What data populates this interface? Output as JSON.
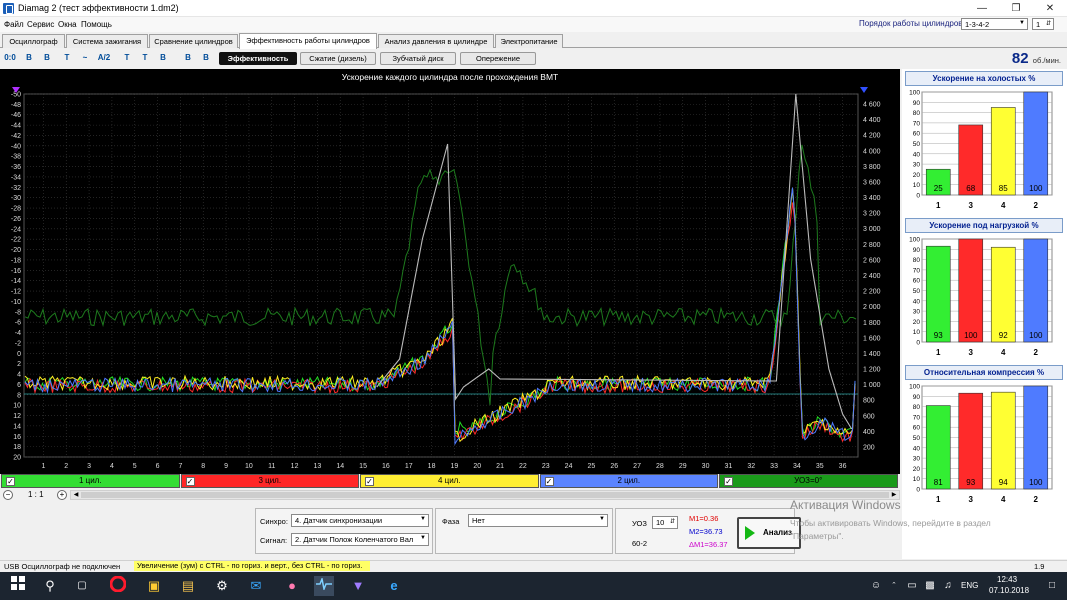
{
  "window": {
    "title": "Diamag 2 (тест эффективности 1.dm2)"
  },
  "menu": [
    "Файл",
    "Сервис",
    "Окна",
    "Помощь"
  ],
  "firing_order": {
    "label": "Порядок работы цилиндров",
    "value": "1-3-4-2",
    "index": "1"
  },
  "tabs": [
    "Осциллограф",
    "Система зажигания",
    "Сравнение цилиндров",
    "Эффективность работы цилиндров",
    "Анализ давления в цилиндре",
    "Электропитание"
  ],
  "toolbar": {
    "icons": [
      "0:0",
      "B",
      "B",
      "T",
      "~",
      "A/2",
      "T",
      "T",
      "B",
      "B",
      "B"
    ],
    "subtabs": [
      "Эффективность",
      "Сжатие (дизель)",
      "Зубчатый диск",
      "Опережение"
    ],
    "rpm_value": "82",
    "rpm_unit": "об./мин."
  },
  "chart": {
    "title": "Ускорение каждого цилиндра после прохождения ВМТ",
    "left_ticks": [
      "-50",
      "-48",
      "-46",
      "-44",
      "-42",
      "-40",
      "-38",
      "-36",
      "-34",
      "-32",
      "-30",
      "-28",
      "-26",
      "-24",
      "-22",
      "-20",
      "-18",
      "-16",
      "-14",
      "-12",
      "-10",
      "-8",
      "-6",
      "-4",
      "-2",
      "0",
      "2",
      "4",
      "6",
      "8",
      "10",
      "12",
      "14",
      "16",
      "18",
      "20"
    ],
    "right_ticks": [
      "4 600",
      "4 400",
      "4 200",
      "4 000",
      "3 800",
      "3 600",
      "3 400",
      "3 200",
      "3 000",
      "2 800",
      "2 600",
      "2 400",
      "2 200",
      "2 000",
      "1 800",
      "1 600",
      "1 400",
      "1 200",
      "1 000",
      "800",
      "600",
      "400",
      "200"
    ],
    "x_ticks": [
      "1",
      "2",
      "3",
      "4",
      "5",
      "6",
      "7",
      "8",
      "9",
      "10",
      "11",
      "12",
      "13",
      "14",
      "15",
      "16",
      "17",
      "18",
      "19",
      "20",
      "21",
      "22",
      "23",
      "24",
      "25",
      "26",
      "27",
      "28",
      "29",
      "30",
      "31",
      "32",
      "33",
      "34",
      "35",
      "36"
    ],
    "colors": {
      "green": "#22dd22",
      "red": "#ff2a2a",
      "yellow": "#ffee22",
      "blue": "#4f7bff",
      "dark_green": "#1d7a1d",
      "gray": "#bbbbbb",
      "teal": "#2aa0a0"
    }
  },
  "cylinders": [
    {
      "label": "1 цил.",
      "color": "#33dd33"
    },
    {
      "label": "3 цил.",
      "color": "#ff2626"
    },
    {
      "label": "4 цил.",
      "color": "#ffee33"
    },
    {
      "label": "2 цил.",
      "color": "#5b84ff"
    },
    {
      "label": "УОЗ=0°",
      "color": "#1a9a1a"
    }
  ],
  "zoom": {
    "ratio": "1 : 1"
  },
  "controls": {
    "sync_label": "Синхро:",
    "sync_value": "4. Датчик синхронизации",
    "signal_label": "Сигнал:",
    "signal_value": "2. Датчик Полож Коленчатого Вал",
    "phase_label": "Фаза",
    "phase_value": "Нет",
    "uoz_label": "УОЗ",
    "uoz_value": "10",
    "disk_value": "60-2",
    "m1": "M1=0.36",
    "m2": "M2=36.73",
    "dm": "ΔM1=36.37",
    "analysis_button": "Анализ"
  },
  "panels": [
    {
      "title": "Ускорение на холостых %",
      "bars": [
        {
          "cyl": "1",
          "value": 25,
          "color": "#33ee33"
        },
        {
          "cyl": "3",
          "value": 68,
          "color": "#ff2a2a"
        },
        {
          "cyl": "4",
          "value": 85,
          "color": "#ffff33"
        },
        {
          "cyl": "2",
          "value": 100,
          "color": "#4f7bff"
        }
      ]
    },
    {
      "title": "Ускорение под нагрузкой %",
      "bars": [
        {
          "cyl": "1",
          "value": 93,
          "color": "#33ee33"
        },
        {
          "cyl": "3",
          "value": 100,
          "color": "#ff2a2a"
        },
        {
          "cyl": "4",
          "value": 92,
          "color": "#ffff33"
        },
        {
          "cyl": "2",
          "value": 100,
          "color": "#4f7bff"
        }
      ]
    },
    {
      "title": "Относительная компрессия %",
      "bars": [
        {
          "cyl": "1",
          "value": 81,
          "color": "#33ee33"
        },
        {
          "cyl": "3",
          "value": 93,
          "color": "#ff2a2a"
        },
        {
          "cyl": "4",
          "value": 94,
          "color": "#ffff33"
        },
        {
          "cyl": "2",
          "value": 100,
          "color": "#4f7bff"
        }
      ]
    }
  ],
  "panel_y_ticks": [
    "100",
    "90",
    "80",
    "70",
    "60",
    "50",
    "40",
    "30",
    "20",
    "10",
    "0"
  ],
  "status": {
    "left": "USB Осциллограф не подключен",
    "hint": "Увеличение (зум) с CTRL - по гориз. и верт., без CTRL - по гориз.",
    "version": "1.9"
  },
  "watermark": {
    "title": "Активация Windows",
    "text": "Чтобы активировать Windows, перейдите в раздел \"Параметры\"."
  },
  "taskbar": {
    "lang": "ENG",
    "time": "12:43",
    "date": "07.10.2018"
  }
}
